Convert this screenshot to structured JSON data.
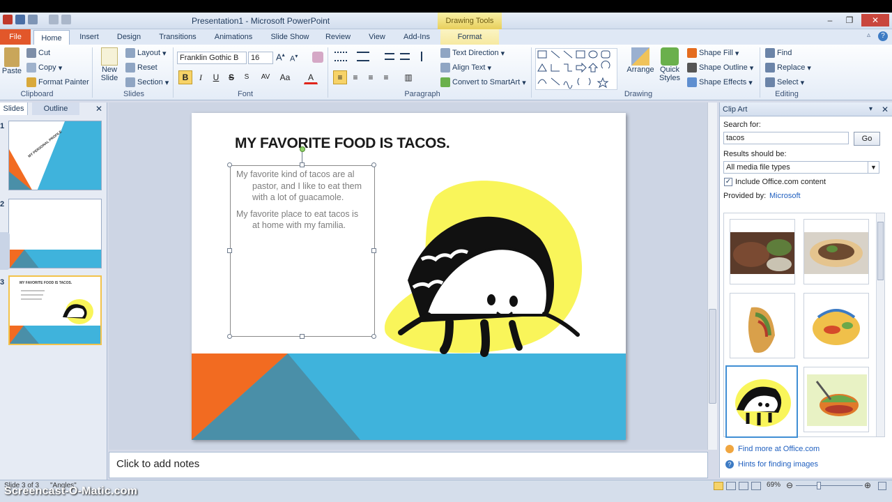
{
  "window": {
    "title": "Presentation1 - Microsoft PowerPoint",
    "context_tab_header": "Drawing Tools",
    "win_buttons": [
      "–",
      "❐",
      "✕"
    ],
    "help": "?"
  },
  "tabs": [
    "File",
    "Home",
    "Insert",
    "Design",
    "Transitions",
    "Animations",
    "Slide Show",
    "Review",
    "View",
    "Add-Ins",
    "Format"
  ],
  "ribbon": {
    "clipboard": {
      "label": "Clipboard",
      "paste": "Paste",
      "cut": "Cut",
      "copy": "Copy",
      "format_painter": "Format Painter"
    },
    "slides": {
      "label": "Slides",
      "new_slide": "New Slide",
      "layout": "Layout",
      "reset": "Reset",
      "section": "Section"
    },
    "font": {
      "label": "Font",
      "font_name": "Franklin Gothic B",
      "font_size": "16",
      "bold": "B",
      "italic": "I",
      "underline": "U",
      "strike": "S",
      "spacing": "AV",
      "case": "Aa",
      "color": "A"
    },
    "paragraph": {
      "label": "Paragraph",
      "text_direction": "Text Direction",
      "align_text": "Align Text",
      "convert_smartart": "Convert to SmartArt"
    },
    "drawing": {
      "label": "Drawing",
      "arrange": "Arrange",
      "quick_styles": "Quick Styles",
      "shape_fill": "Shape Fill",
      "shape_outline": "Shape Outline",
      "shape_effects": "Shape Effects"
    },
    "editing": {
      "label": "Editing",
      "find": "Find",
      "replace": "Replace",
      "select": "Select"
    }
  },
  "slides_pane": {
    "tab_slides": "Slides",
    "tab_outline": "Outline",
    "close": "✕",
    "numbers": [
      "1",
      "2",
      "3"
    ],
    "thumb1_text": "MY PERSONAL PROFILE",
    "thumb3_text": "MY FAVORITE FOOD IS TACOS."
  },
  "slide": {
    "title": "MY FAVORITE FOOD IS TACOS.",
    "para1_lines": [
      "My favorite kind of tacos are al",
      "pastor, and I like to eat them",
      "with a lot of guacamole."
    ],
    "para2_lines": [
      "My favorite place to eat tacos is",
      "at home with my familia."
    ]
  },
  "notes": {
    "placeholder": "Click to add notes"
  },
  "clipart": {
    "pane_title": "Clip Art",
    "search_label": "Search for:",
    "search_value": "tacos",
    "go": "Go",
    "results_label": "Results should be:",
    "results_value": "All media file types",
    "include_office": "Include Office.com content",
    "provided_by": "Provided by:",
    "provider": "Microsoft",
    "find_more": "Find more at Office.com",
    "hints": "Hints for finding images"
  },
  "status": {
    "slide_info": "Slide 3 of 3",
    "theme": "\"Angles\"",
    "zoom": "69%"
  },
  "watermark": "Screencast-O-Matic.com",
  "colors": {
    "orange": "#f26b21",
    "teal": "#4a8fa8",
    "sky": "#3fb3dc",
    "yellow": "#f9f55a",
    "accent_file": "#e2572a"
  }
}
